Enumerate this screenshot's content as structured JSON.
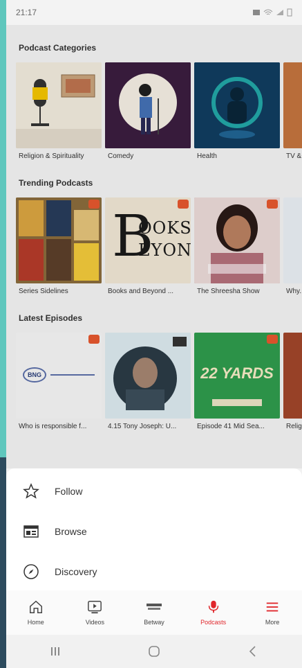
{
  "status": {
    "time": "21:17"
  },
  "categories": {
    "title": "Podcast Categories",
    "items": [
      {
        "label": "Religion & Spirituality",
        "color": "#f0e9dc"
      },
      {
        "label": "Comedy",
        "color": "#3a1d3f"
      },
      {
        "label": "Health",
        "color": "#0f3a5a"
      },
      {
        "label": "TV & Film",
        "color": "#c2733e"
      }
    ]
  },
  "trending": {
    "title": "Trending Podcasts",
    "items": [
      {
        "label": "Series Sidelines",
        "color": "#8a6b3c"
      },
      {
        "label": "Books and Beyond ...",
        "color": "#efe5d3",
        "art_text_1": "OOKS",
        "art_text_2": "EYOND",
        "art_letter": "B"
      },
      {
        "label": "The Shreesha Show",
        "color": "#b98c8a"
      },
      {
        "label": "Why...",
        "color": "#e8eef3"
      }
    ]
  },
  "latest": {
    "title": "Latest Episodes",
    "items": [
      {
        "label": "Who is responsible f...",
        "color": "#f4f4f4",
        "logo_text": "BNG"
      },
      {
        "label": "4.15 Tony Joseph: U...",
        "color": "#dfe9ee"
      },
      {
        "label": "Episode 41 Mid Sea...",
        "color": "#2f9a4c",
        "art_text": "22 YARDS"
      },
      {
        "label": "Relig...",
        "color": "#a0452a"
      }
    ]
  },
  "menu": {
    "items": [
      {
        "label": "Follow",
        "icon": "star-icon"
      },
      {
        "label": "Browse",
        "icon": "browse-icon"
      },
      {
        "label": "Discovery",
        "icon": "compass-icon"
      }
    ]
  },
  "tabs": [
    {
      "label": "Home",
      "icon": "home-icon"
    },
    {
      "label": "Videos",
      "icon": "video-icon"
    },
    {
      "label": "Betway",
      "icon": "betway-icon"
    },
    {
      "label": "Podcasts",
      "icon": "microphone-icon",
      "active": true
    },
    {
      "label": "More",
      "icon": "menu-icon"
    }
  ],
  "colors": {
    "accent": "#e0262b",
    "teal_bg": "#5fc7bd"
  }
}
